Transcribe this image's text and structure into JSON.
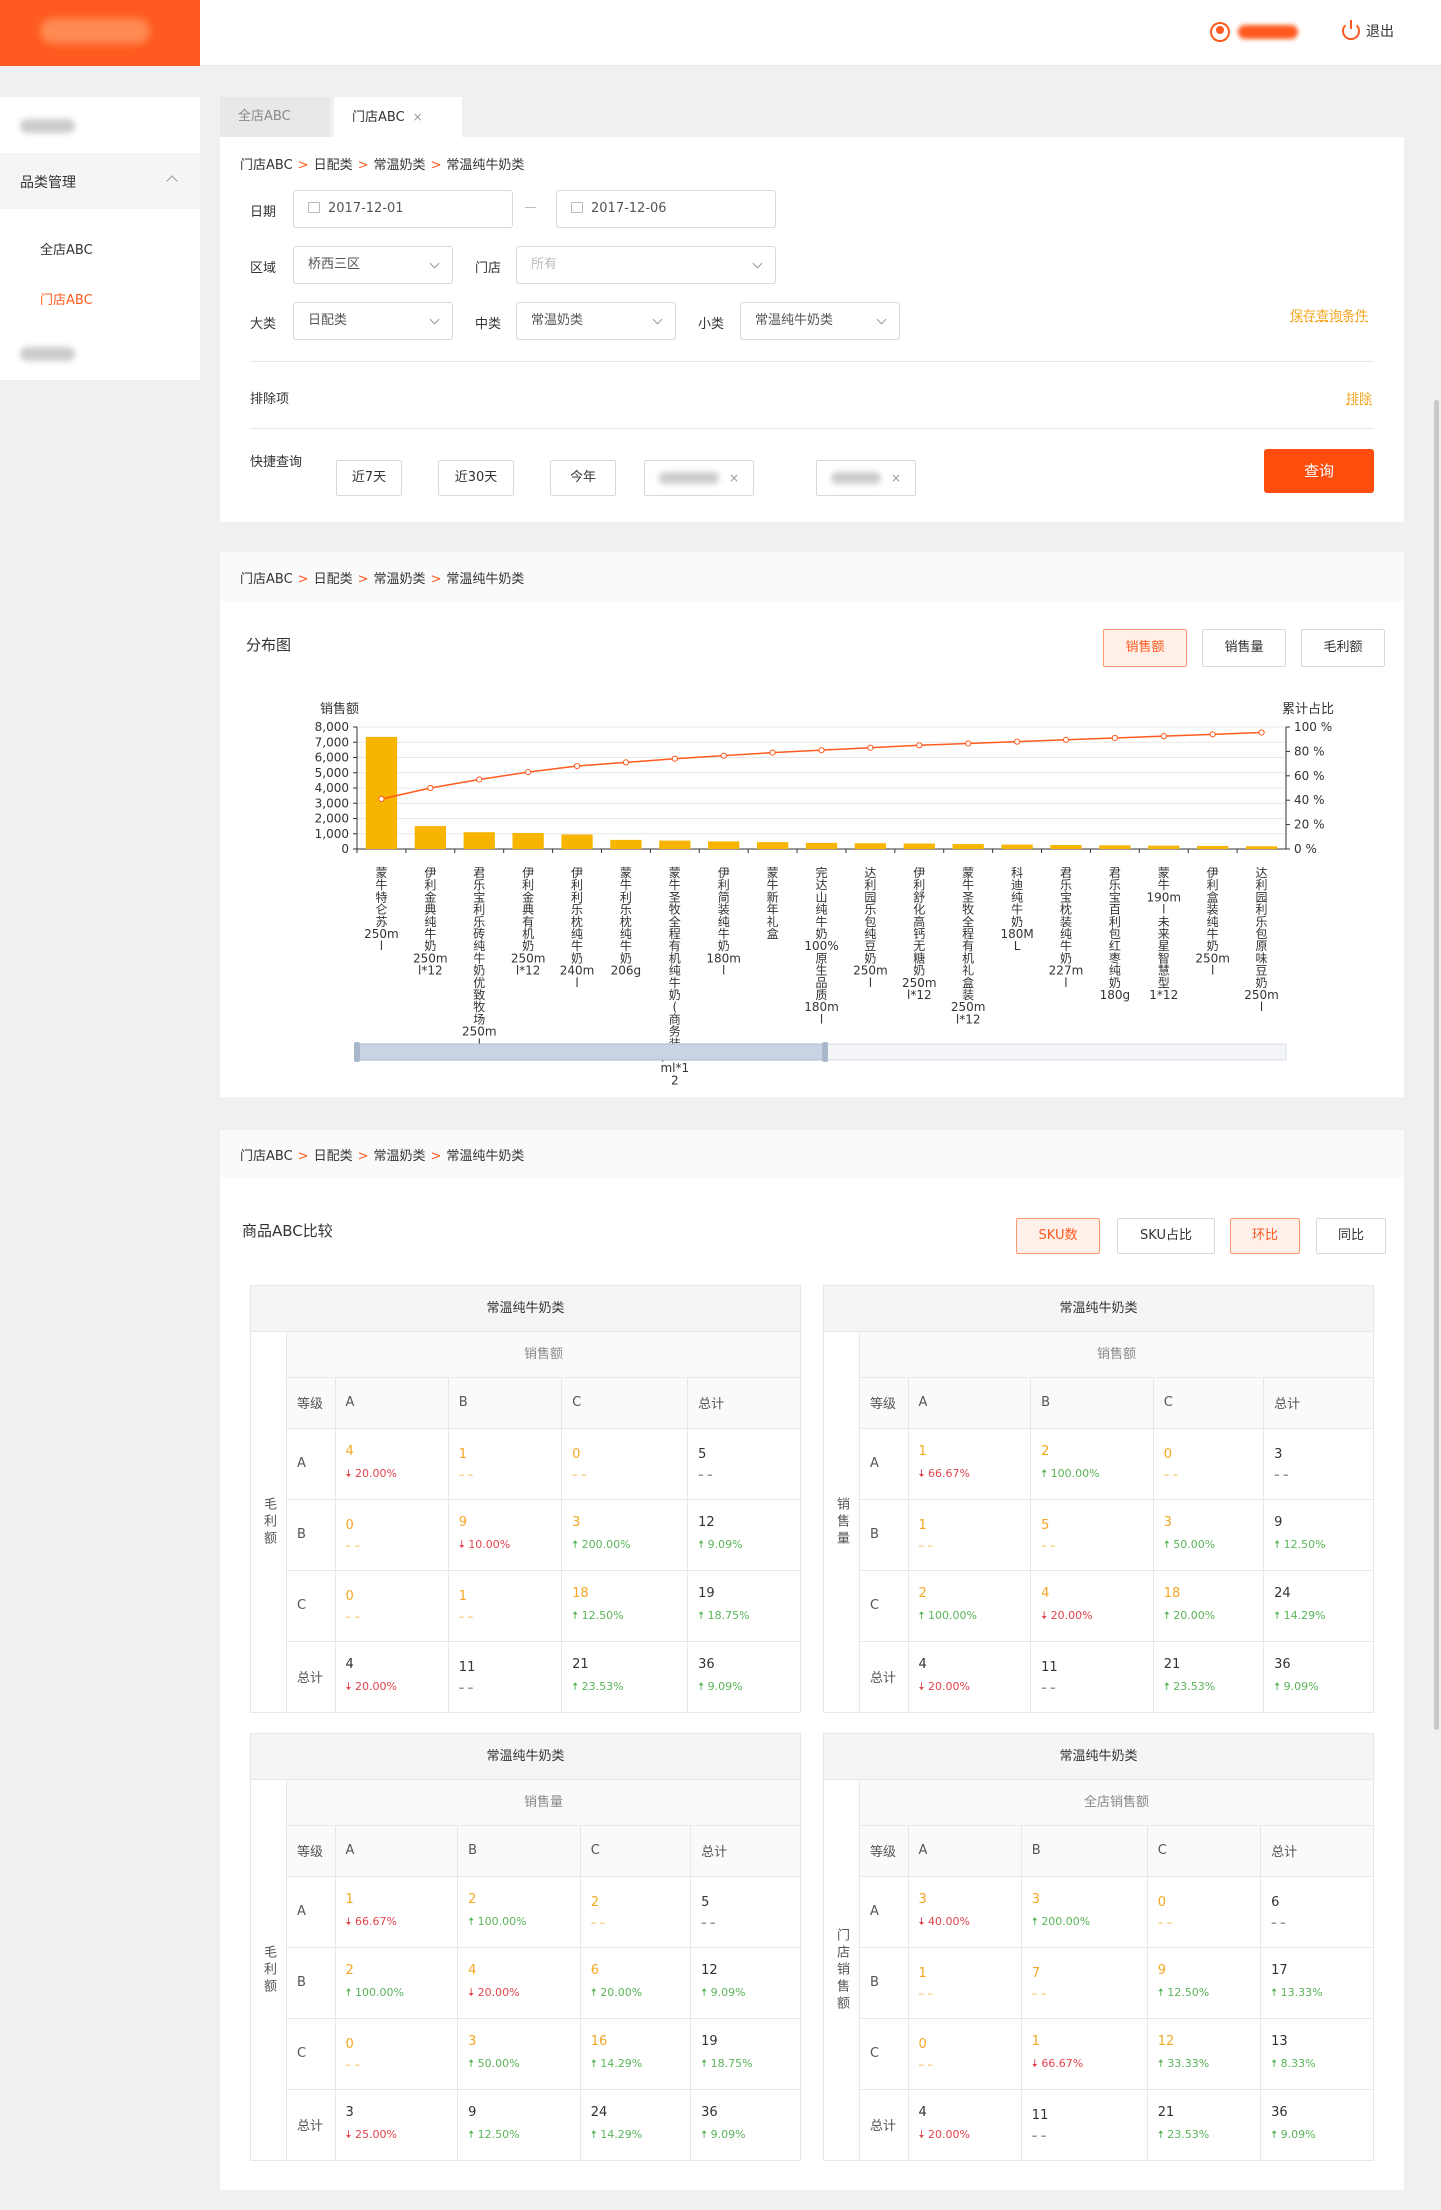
{
  "header": {
    "logout": "退出"
  },
  "sidebar": {
    "section": "品类管理",
    "items": [
      "全店ABC",
      "门店ABC"
    ]
  },
  "tabs": [
    {
      "label": "全店ABC"
    },
    {
      "label": "门店ABC",
      "close": "×"
    }
  ],
  "breadcrumb": [
    "门店ABC",
    "日配类",
    "常温奶类",
    "常温纯牛奶类"
  ],
  "breadcrumb_sep": ">",
  "filters": {
    "date_label": "日期",
    "date_from": "2017-12-01",
    "date_sep": "—",
    "date_to": "2017-12-06",
    "region_label": "区域",
    "region_value": "桥西三区",
    "store_label": "门店",
    "store_value": "所有",
    "big_label": "大类",
    "big_value": "日配类",
    "mid_label": "中类",
    "mid_value": "常温奶类",
    "small_label": "小类",
    "small_value": "常温纯牛奶类",
    "save_link": "保存查询条件",
    "exclude_label": "排除项",
    "exclude_link": "排除",
    "quick_label": "快捷查询",
    "quick": [
      "近7天",
      "近30天",
      "今年"
    ],
    "chip_close": "×",
    "query_button": "查询"
  },
  "distribution": {
    "title": "分布图",
    "buttons": [
      "销售额",
      "销售量",
      "毛利额"
    ],
    "active_button": 0
  },
  "chart_data": {
    "type": "bar",
    "ylabel": "销售额",
    "y2label": "累计占比",
    "ylim": [
      0,
      8000
    ],
    "yticks": [
      "0",
      "1,000",
      "2,000",
      "3,000",
      "4,000",
      "5,000",
      "6,000",
      "7,000",
      "8,000"
    ],
    "y2lim": [
      0,
      100
    ],
    "y2ticks": [
      "0 %",
      "20 %",
      "40 %",
      "60 %",
      "80 %",
      "100 %"
    ],
    "categories": [
      "蒙牛特仑苏250ml",
      "伊利金典纯牛奶250ml*12",
      "君乐宝利乐砖纯牛奶优致牧场250ml",
      "伊利金典有机奶250ml*12",
      "伊利利乐枕纯牛奶240ml",
      "蒙牛利乐枕纯牛奶206g",
      "蒙牛圣牧全程有机纯牛奶(商务装)250ml*12",
      "伊利简装纯牛奶180ml",
      "蒙牛新年礼盒",
      "完达山纯牛奶100%原生品质180ml",
      "达利园乐包纯豆奶250ml",
      "伊利舒化高钙无糖奶250ml*12",
      "蒙牛圣牧全程有机礼盒装250ml*12",
      "科迪纯牛奶180ML",
      "君乐宝枕装纯牛奶227ml",
      "君乐宝百利包红枣纯奶180g",
      "蒙牛190ml未来星智慧型1*12",
      "伊利盒装纯牛奶250ml",
      "达利园利乐包原味豆奶250ml"
    ],
    "series": [
      {
        "type": "bar",
        "values": [
          7350,
          1500,
          1100,
          1050,
          950,
          600,
          550,
          500,
          450,
          400,
          380,
          360,
          320,
          290,
          260,
          240,
          220,
          200,
          180
        ],
        "color": "#f8b500"
      },
      {
        "type": "line",
        "values": [
          41,
          50,
          57,
          63,
          68,
          71,
          74,
          76.5,
          79,
          81,
          83,
          85,
          86.5,
          88,
          89.5,
          91,
          92.5,
          94,
          95.5
        ],
        "color": "#ff5a1f"
      }
    ],
    "grid": true
  },
  "abc": {
    "title": "商品ABC比较",
    "buttons": [
      "SKU数",
      "SKU占比",
      "环比",
      "同比"
    ],
    "active": [
      0,
      2
    ],
    "header_grade": "等级",
    "cols": [
      "A",
      "B",
      "C",
      "总计"
    ],
    "row_labels": [
      "A",
      "B",
      "C",
      "总计"
    ],
    "tables": [
      {
        "title": "常温纯牛奶类",
        "sub": "销售额",
        "vlabel": "毛利额",
        "rows": [
          [
            {
              "v": "4",
              "c": "20.00%",
              "d": "dn"
            },
            {
              "v": "1",
              "c": "– –",
              "d": "dd"
            },
            {
              "v": "0",
              "c": "– –",
              "d": "dd"
            },
            {
              "v": "5",
              "c": "– –",
              "d": "kd"
            }
          ],
          [
            {
              "v": "0",
              "c": "– –",
              "d": "dd"
            },
            {
              "v": "9",
              "c": "10.00%",
              "d": "dn"
            },
            {
              "v": "3",
              "c": "200.00%",
              "d": "up"
            },
            {
              "v": "12",
              "c": "9.09%",
              "d": "up"
            }
          ],
          [
            {
              "v": "0",
              "c": "– –",
              "d": "dd"
            },
            {
              "v": "1",
              "c": "– –",
              "d": "dd"
            },
            {
              "v": "18",
              "c": "12.50%",
              "d": "up"
            },
            {
              "v": "19",
              "c": "18.75%",
              "d": "up"
            }
          ],
          [
            {
              "v": "4",
              "c": "20.00%",
              "d": "dn"
            },
            {
              "v": "11",
              "c": "– –",
              "d": "kd"
            },
            {
              "v": "21",
              "c": "23.53%",
              "d": "up"
            },
            {
              "v": "36",
              "c": "9.09%",
              "d": "up"
            }
          ]
        ]
      },
      {
        "title": "常温纯牛奶类",
        "sub": "销售额",
        "vlabel": "销售量",
        "rows": [
          [
            {
              "v": "1",
              "c": "66.67%",
              "d": "dn"
            },
            {
              "v": "2",
              "c": "100.00%",
              "d": "up"
            },
            {
              "v": "0",
              "c": "– –",
              "d": "dd"
            },
            {
              "v": "3",
              "c": "– –",
              "d": "kd"
            }
          ],
          [
            {
              "v": "1",
              "c": "– –",
              "d": "dd"
            },
            {
              "v": "5",
              "c": "– –",
              "d": "dd"
            },
            {
              "v": "3",
              "c": "50.00%",
              "d": "up"
            },
            {
              "v": "9",
              "c": "12.50%",
              "d": "up"
            }
          ],
          [
            {
              "v": "2",
              "c": "100.00%",
              "d": "up"
            },
            {
              "v": "4",
              "c": "20.00%",
              "d": "dn"
            },
            {
              "v": "18",
              "c": "20.00%",
              "d": "up"
            },
            {
              "v": "24",
              "c": "14.29%",
              "d": "up"
            }
          ],
          [
            {
              "v": "4",
              "c": "20.00%",
              "d": "dn"
            },
            {
              "v": "11",
              "c": "– –",
              "d": "kd"
            },
            {
              "v": "21",
              "c": "23.53%",
              "d": "up"
            },
            {
              "v": "36",
              "c": "9.09%",
              "d": "up"
            }
          ]
        ]
      },
      {
        "title": "常温纯牛奶类",
        "sub": "销售量",
        "vlabel": "毛利额",
        "rows": [
          [
            {
              "v": "1",
              "c": "66.67%",
              "d": "dn"
            },
            {
              "v": "2",
              "c": "100.00%",
              "d": "up"
            },
            {
              "v": "2",
              "c": "– –",
              "d": "dd"
            },
            {
              "v": "5",
              "c": "– –",
              "d": "kd"
            }
          ],
          [
            {
              "v": "2",
              "c": "100.00%",
              "d": "up"
            },
            {
              "v": "4",
              "c": "20.00%",
              "d": "dn"
            },
            {
              "v": "6",
              "c": "20.00%",
              "d": "up"
            },
            {
              "v": "12",
              "c": "9.09%",
              "d": "up"
            }
          ],
          [
            {
              "v": "0",
              "c": "– –",
              "d": "dd"
            },
            {
              "v": "3",
              "c": "50.00%",
              "d": "up"
            },
            {
              "v": "16",
              "c": "14.29%",
              "d": "up"
            },
            {
              "v": "19",
              "c": "18.75%",
              "d": "up"
            }
          ],
          [
            {
              "v": "3",
              "c": "25.00%",
              "d": "dn",
              "k": true
            },
            {
              "v": "9",
              "c": "12.50%",
              "d": "up",
              "k": true
            },
            {
              "v": "24",
              "c": "14.29%",
              "d": "up",
              "k": true
            },
            {
              "v": "36",
              "c": "9.09%",
              "d": "up",
              "k": true
            }
          ]
        ]
      },
      {
        "title": "常温纯牛奶类",
        "sub": "全店销售额",
        "vlabel": "门店销售额",
        "rows": [
          [
            {
              "v": "3",
              "c": "40.00%",
              "d": "dn"
            },
            {
              "v": "3",
              "c": "200.00%",
              "d": "up"
            },
            {
              "v": "0",
              "c": "– –",
              "d": "dd"
            },
            {
              "v": "6",
              "c": "– –",
              "d": "kd"
            }
          ],
          [
            {
              "v": "1",
              "c": "– –",
              "d": "dd"
            },
            {
              "v": "7",
              "c": "– –",
              "d": "dd"
            },
            {
              "v": "9",
              "c": "12.50%",
              "d": "up"
            },
            {
              "v": "17",
              "c": "13.33%",
              "d": "up"
            }
          ],
          [
            {
              "v": "0",
              "c": "– –",
              "d": "dd"
            },
            {
              "v": "1",
              "c": "66.67%",
              "d": "dn"
            },
            {
              "v": "12",
              "c": "33.33%",
              "d": "up"
            },
            {
              "v": "13",
              "c": "8.33%",
              "d": "up"
            }
          ],
          [
            {
              "v": "4",
              "c": "20.00%",
              "d": "dn",
              "k": true
            },
            {
              "v": "11",
              "c": "– –",
              "d": "kd",
              "k": true
            },
            {
              "v": "21",
              "c": "23.53%",
              "d": "up",
              "k": true
            },
            {
              "v": "36",
              "c": "9.09%",
              "d": "up",
              "k": true
            }
          ]
        ]
      }
    ]
  }
}
